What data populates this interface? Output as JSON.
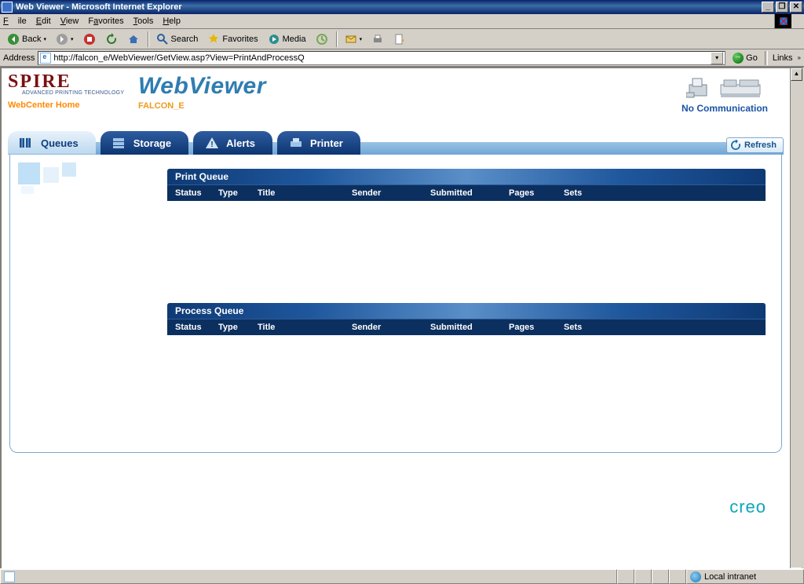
{
  "window": {
    "title": "Web Viewer - Microsoft Internet Explorer"
  },
  "menus": {
    "file": "File",
    "edit": "Edit",
    "view": "View",
    "favorites": "Favorites",
    "tools": "Tools",
    "help": "Help"
  },
  "toolbar": {
    "back": "Back",
    "search": "Search",
    "favorites": "Favorites",
    "media": "Media"
  },
  "address": {
    "label": "Address",
    "url": "http://falcon_e/WebViewer/GetView.asp?View=PrintAndProcessQ",
    "go": "Go",
    "links": "Links"
  },
  "brand": {
    "spire": "SPIRE",
    "tag": "ADVANCED PRINTING TECHNOLOGY",
    "home": "WebCenter Home"
  },
  "app": {
    "title": "WebViewer",
    "server": "FALCON_E",
    "status": "No Communication",
    "creo": "creo"
  },
  "tabs": {
    "queues": "Queues",
    "storage": "Storage",
    "alerts": "Alerts",
    "printer": "Printer",
    "refresh": "Refresh"
  },
  "queues": {
    "print": {
      "title": "Print Queue"
    },
    "process": {
      "title": "Process Queue"
    },
    "cols": {
      "status": "Status",
      "type": "Type",
      "title": "Title",
      "sender": "Sender",
      "submitted": "Submitted",
      "pages": "Pages",
      "sets": "Sets"
    }
  },
  "statusbar": {
    "zone": "Local intranet"
  }
}
